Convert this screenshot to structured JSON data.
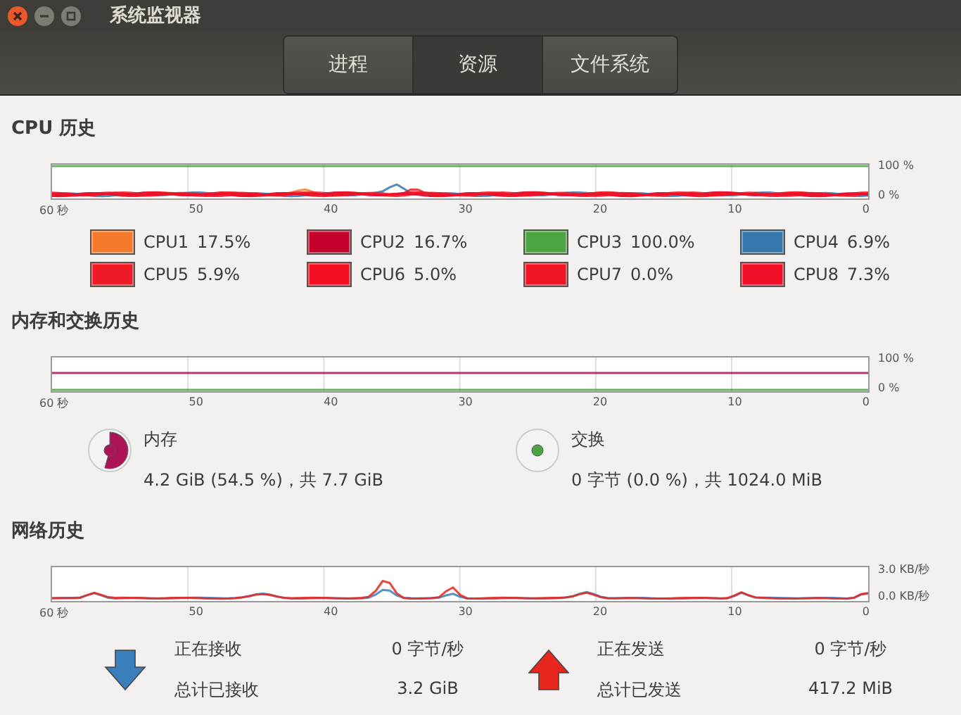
{
  "window": {
    "title": "系统监视器"
  },
  "tabs": [
    {
      "label": "进程",
      "selected": false
    },
    {
      "label": "资源",
      "selected": true
    },
    {
      "label": "文件系统",
      "selected": false
    }
  ],
  "cpu": {
    "title": "CPU 历史",
    "y_labels": [
      "100 %",
      "0 %"
    ],
    "x_labels": [
      "60 秒",
      "50",
      "40",
      "30",
      "20",
      "10",
      "0"
    ],
    "legend": [
      {
        "label": "CPU1",
        "value": "17.5%",
        "color": "#f5792a"
      },
      {
        "label": "CPU2",
        "value": "16.7%",
        "color": "#c3002c"
      },
      {
        "label": "CPU3",
        "value": "100.0%",
        "color": "#4ca442"
      },
      {
        "label": "CPU4",
        "value": "6.9%",
        "color": "#3576ad"
      },
      {
        "label": "CPU5",
        "value": "5.9%",
        "color": "#ee1b26"
      },
      {
        "label": "CPU6",
        "value": "5.0%",
        "color": "#f40f22"
      },
      {
        "label": "CPU7",
        "value": "0.0%",
        "color": "#ef1424"
      },
      {
        "label": "CPU8",
        "value": "7.3%",
        "color": "#f0102a"
      }
    ]
  },
  "memory": {
    "title": "内存和交换历史",
    "y_labels": [
      "100 %",
      "0 %"
    ],
    "x_labels": [
      "60 秒",
      "50",
      "40",
      "30",
      "20",
      "10",
      "0"
    ],
    "items": [
      {
        "kind": "memory",
        "label": "内存",
        "value": "4.2 GiB (54.5 %)，共 7.7 GiB",
        "color": "#ad1457"
      },
      {
        "kind": "swap",
        "label": "交换",
        "value": "0 字节 (0.0 %)，共 1024.0 MiB",
        "color": "#4ca442"
      }
    ]
  },
  "network": {
    "title": "网络历史",
    "y_labels": [
      "3.0 KB/秒",
      "0.0 KB/秒"
    ],
    "x_labels": [
      "60 秒",
      "50",
      "40",
      "30",
      "20",
      "10",
      "0"
    ],
    "items": [
      {
        "kind": "receive",
        "color": "#3a7fbd",
        "label": "正在接收",
        "rate": "0 字节/秒",
        "total_label": "总计已接收",
        "total": "3.2 GiB"
      },
      {
        "kind": "send",
        "color": "#e8261c",
        "label": "正在发送",
        "rate": "0 字节/秒",
        "total_label": "总计已发送",
        "total": "417.2 MiB"
      }
    ]
  }
}
